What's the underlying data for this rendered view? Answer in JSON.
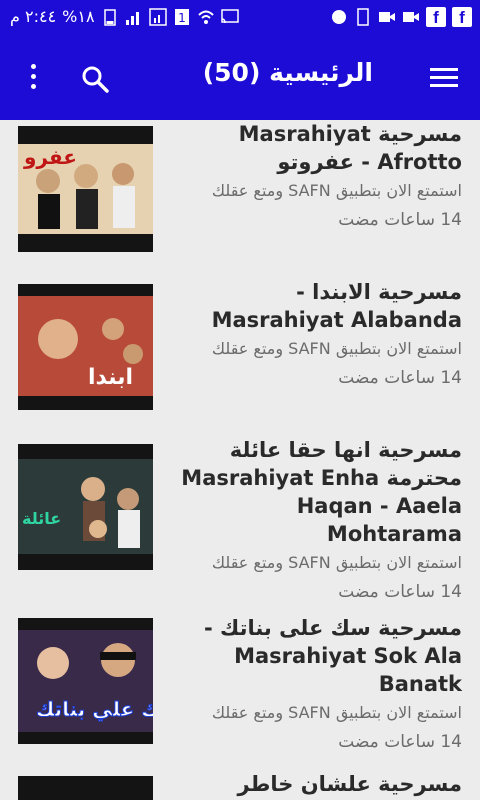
{
  "status_bar": {
    "time": "٢:٤٤ م",
    "battery": "%١٨"
  },
  "app_bar": {
    "title": "الرئيسية (50)"
  },
  "items": [
    {
      "title": "مسرحية Masrahiyat Afrotto - عفروتو",
      "subtitle": "استمتع الان بتطبيق SAFN ومتع عقلك",
      "time": "14 ساعات مضت"
    },
    {
      "title": "مسرحية الابندا - Masrahiyat Alabanda",
      "subtitle": "استمتع الان بتطبيق SAFN ومتع عقلك",
      "time": "14 ساعات مضت"
    },
    {
      "title": "مسرحية انها حقا عائلة محترمة Masrahiyat Enha Haqan - Aaela Mohtarama",
      "subtitle": "استمتع الان بتطبيق SAFN ومتع عقلك",
      "time": "14 ساعات مضت"
    },
    {
      "title": "مسرحية سك على بناتك - Masrahiyat Sok Ala Banatk",
      "subtitle": "استمتع الان بتطبيق SAFN ومتع عقلك",
      "time": "14 ساعات مضت"
    },
    {
      "title": "مسرحية علشان خاطر عيونك -",
      "subtitle": "",
      "time": ""
    }
  ],
  "colors": {
    "primary": "#1d0bd6",
    "background": "#ececec"
  }
}
